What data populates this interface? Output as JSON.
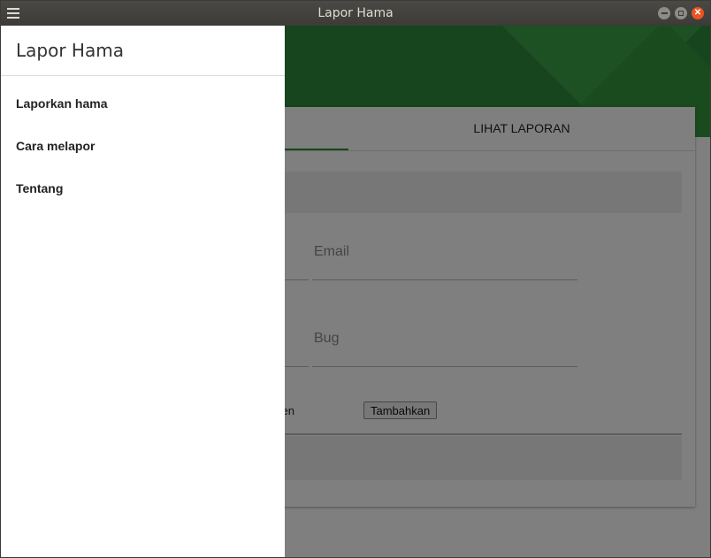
{
  "window": {
    "title": "Lapor Hama"
  },
  "tabs": [
    {
      "label": ""
    },
    {
      "label": "LIHAT LAPORAN"
    }
  ],
  "form": {
    "email_placeholder": "Email",
    "bug_placeholder": "Bug",
    "file_label_visible": "en",
    "add_button_label": "Tambahkan"
  },
  "drawer": {
    "title": "Lapor Hama",
    "items": [
      {
        "label": "Laporkan hama"
      },
      {
        "label": "Cara melapor"
      },
      {
        "label": "Tentang"
      }
    ]
  },
  "colors": {
    "primary": "#2e8b3a",
    "titlebar": "#3c3b37",
    "close_button": "#e95420"
  }
}
